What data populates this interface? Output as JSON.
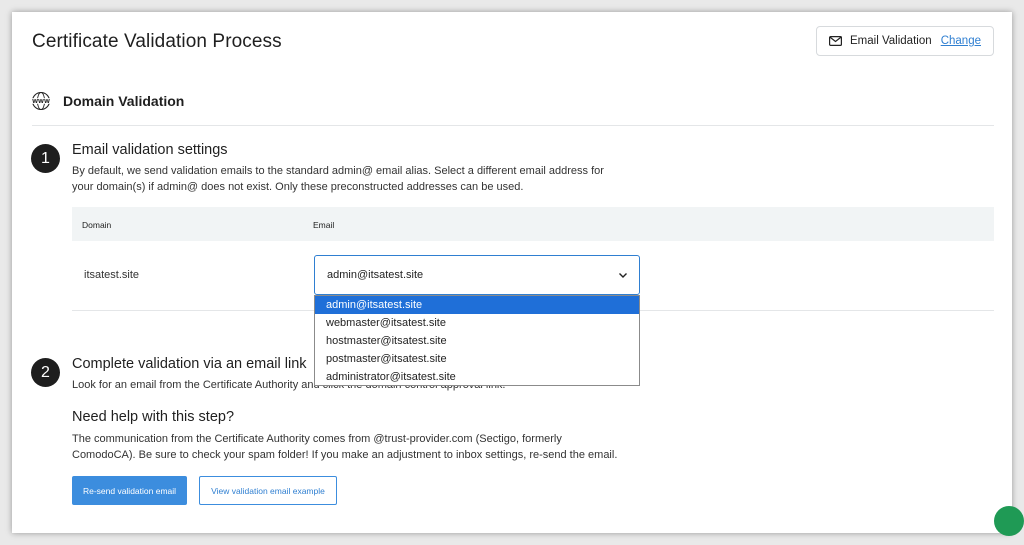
{
  "header": {
    "title": "Certificate Validation Process",
    "validation_method": "Email Validation",
    "change_label": "Change"
  },
  "domain_section": {
    "icon": "www-globe-icon",
    "title": "Domain Validation"
  },
  "step1": {
    "number": "1",
    "title": "Email validation settings",
    "desc_line1": "By default, we send validation emails to the standard admin@ email alias. Select a different email address for",
    "desc_line2": "your domain(s) if admin@ does not exist. Only these preconstructed addresses can be used."
  },
  "table": {
    "headers": [
      "Domain",
      "Email"
    ],
    "rows": [
      {
        "domain": "itsatest.site",
        "email": "admin@itsatest.site"
      }
    ]
  },
  "dropdown": {
    "options": [
      "admin@itsatest.site",
      "webmaster@itsatest.site",
      "hostmaster@itsatest.site",
      "postmaster@itsatest.site",
      "administrator@itsatest.site"
    ],
    "selected": "admin@itsatest.site"
  },
  "step2": {
    "number": "2",
    "title": "Complete validation via an email link",
    "desc": "Look for an email from the Certificate Authority and click the domain control approval link."
  },
  "help": {
    "title": "Need help with this step?",
    "line1": "The communication from the Certificate Authority comes from @trust-provider.com (Sectigo, formerly",
    "line2": "ComodoCA). Be sure to check your spam folder! If you make an adjustment to inbox settings, re-send the email."
  },
  "buttons": {
    "resend": "Re-send validation email",
    "view_example": "View validation email example"
  },
  "colors": {
    "accent": "#3c8dde",
    "link": "#2f7fd1",
    "selected_option": "#1f6fd8",
    "step_badge": "#1e1e1e"
  }
}
